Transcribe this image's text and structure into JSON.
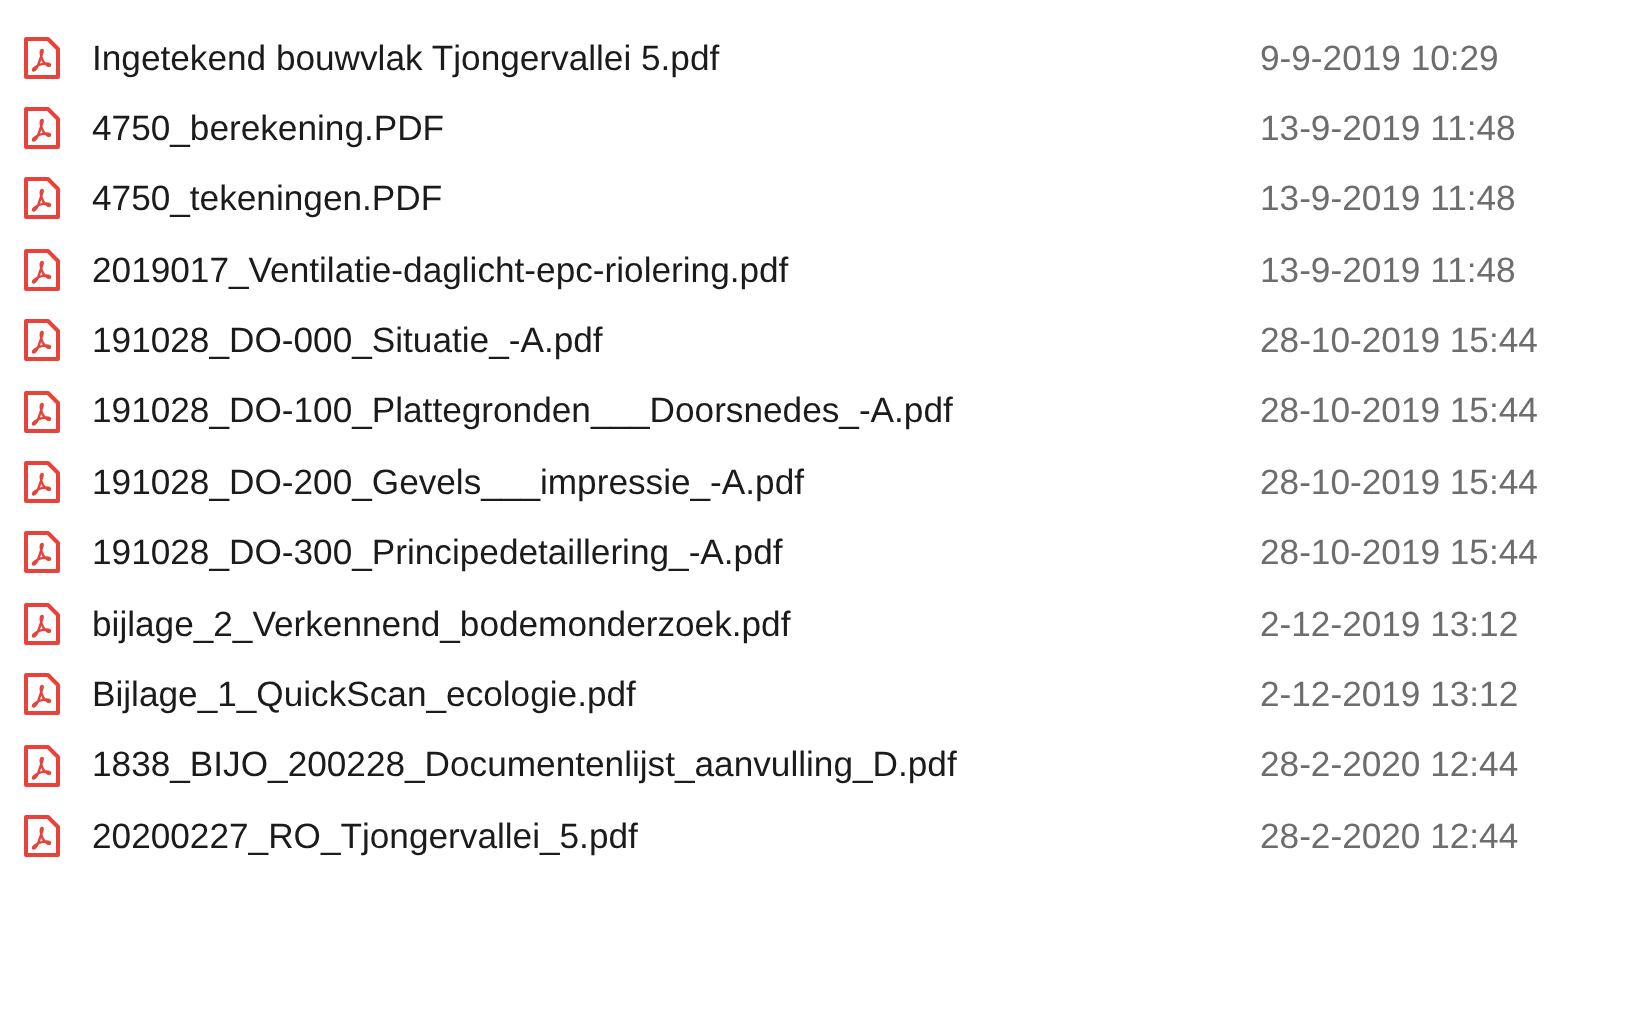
{
  "files": [
    {
      "name": "Ingetekend bouwvlak Tjongervallei 5.pdf",
      "modified": "9-9-2019 10:29"
    },
    {
      "name": "4750_berekening.PDF",
      "modified": "13-9-2019 11:48"
    },
    {
      "name": "4750_tekeningen.PDF",
      "modified": "13-9-2019 11:48"
    },
    {
      "name": "2019017_Ventilatie-daglicht-epc-riolering.pdf",
      "modified": "13-9-2019 11:48"
    },
    {
      "name": "191028_DO-000_Situatie_-A.pdf",
      "modified": "28-10-2019 15:44"
    },
    {
      "name": "191028_DO-100_Plattegronden___Doorsnedes_-A.pdf",
      "modified": "28-10-2019 15:44"
    },
    {
      "name": "191028_DO-200_Gevels___impressie_-A.pdf",
      "modified": "28-10-2019 15:44"
    },
    {
      "name": "191028_DO-300_Principedetaillering_-A.pdf",
      "modified": "28-10-2019 15:44"
    },
    {
      "name": "bijlage_2_Verkennend_bodemonderzoek.pdf",
      "modified": "2-12-2019 13:12"
    },
    {
      "name": "Bijlage_1_QuickScan_ecologie.pdf",
      "modified": "2-12-2019 13:12"
    },
    {
      "name": "1838_BIJO_200228_Documentenlijst_aanvulling_D.pdf",
      "modified": "28-2-2020 12:44"
    },
    {
      "name": "20200227_RO_Tjongervallei_5.pdf",
      "modified": "28-2-2020 12:44"
    }
  ]
}
